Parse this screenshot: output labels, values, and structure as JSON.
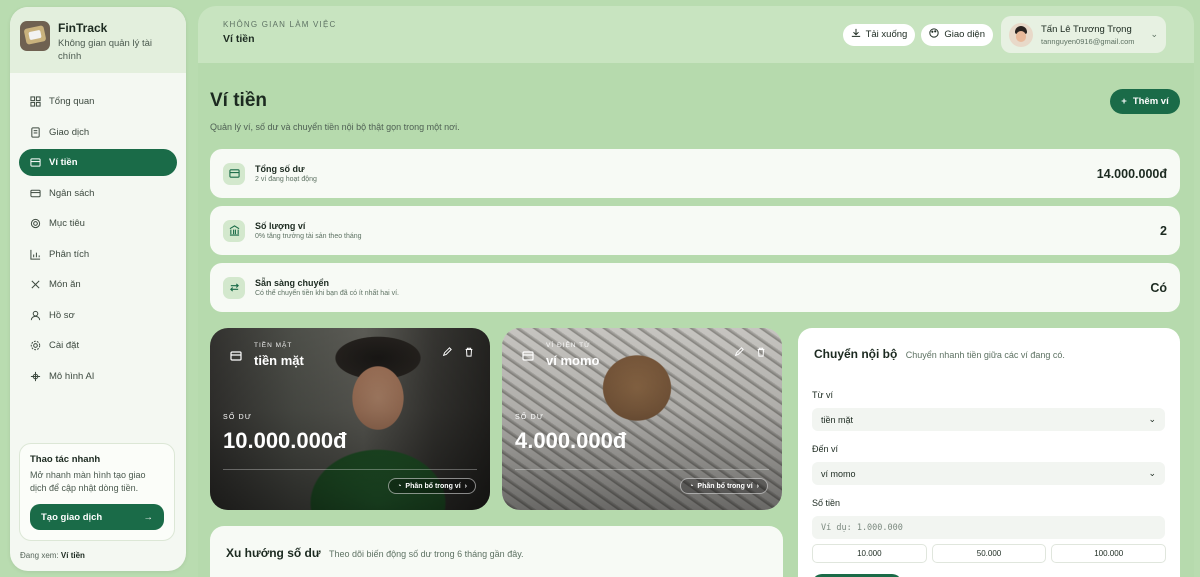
{
  "brand": {
    "name": "FinTrack",
    "tagline": "Không gian quản lý tài chính"
  },
  "nav": {
    "items": [
      {
        "label": "Tổng quan",
        "icon": "grid-icon"
      },
      {
        "label": "Giao dịch",
        "icon": "receipt-icon"
      },
      {
        "label": "Ví tiền",
        "icon": "wallet-icon",
        "active": true
      },
      {
        "label": "Ngân sách",
        "icon": "card-icon"
      },
      {
        "label": "Mục tiêu",
        "icon": "target-icon"
      },
      {
        "label": "Phân tích",
        "icon": "chart-icon"
      },
      {
        "label": "Món ăn",
        "icon": "utensils-icon"
      },
      {
        "label": "Hồ sơ",
        "icon": "user-icon"
      },
      {
        "label": "Cài đặt",
        "icon": "gear-icon"
      },
      {
        "label": "Mô hình AI",
        "icon": "ai-icon"
      }
    ]
  },
  "quick": {
    "title": "Thao tác nhanh",
    "desc": "Mở nhanh màn hình tạo giao dịch để cập nhật dòng tiền.",
    "button": "Tạo giao dịch"
  },
  "viewing": {
    "prefix": "Đang xem:",
    "page": "Ví tiền"
  },
  "topbar": {
    "workspace_label": "KHÔNG GIAN LÀM VIỆC",
    "workspace_title": "Ví tiền",
    "download": "Tải xuống",
    "theme": "Giao diện",
    "user_name": "Tấn Lê Trương Trọng",
    "user_email": "tannguyen0916@gmail.com"
  },
  "page": {
    "title": "Ví tiền",
    "subtitle": "Quản lý ví, số dư và chuyển tiền nội bộ thật gọn trong một nơi.",
    "add_wallet": "Thêm ví"
  },
  "stats": [
    {
      "label": "Tổng số dư",
      "sub": "2 ví đang hoạt động",
      "value": "14.000.000đ"
    },
    {
      "label": "Số lượng ví",
      "sub": "0% tăng trưởng tài sản theo tháng",
      "value": "2"
    },
    {
      "label": "Sẵn sàng chuyển",
      "sub": "Có thể chuyển tiền khi bạn đã có ít nhất hai ví.",
      "value": "Có"
    }
  ],
  "wallets": [
    {
      "type": "TIỀN MẶT",
      "name": "tiền mặt",
      "balance_label": "SỐ DƯ",
      "balance": "10.000.000đ",
      "alloc": "Phân bổ trong ví"
    },
    {
      "type": "VÍ ĐIỆN TỬ",
      "name": "ví momo",
      "balance_label": "SỐ DƯ",
      "balance": "4.000.000đ",
      "alloc": "Phân bổ trong ví"
    }
  ],
  "trend": {
    "title": "Xu hướng số dư",
    "sub": "Theo dõi biến động số dư trong 6 tháng gần đây."
  },
  "transfer": {
    "title": "Chuyển nội bộ",
    "sub": "Chuyển nhanh tiền giữa các ví đang có.",
    "from_label": "Từ ví",
    "from_value": "tiền mặt",
    "to_label": "Đến ví",
    "to_value": "ví momo",
    "amount_label": "Số tiền",
    "amount_placeholder": "Ví dụ: 1.000.000",
    "chips": [
      "10.000",
      "50.000",
      "100.000"
    ]
  },
  "colors": {
    "accent": "#1a6b48",
    "background": "#b9dcb0",
    "card": "#f7faf5"
  }
}
